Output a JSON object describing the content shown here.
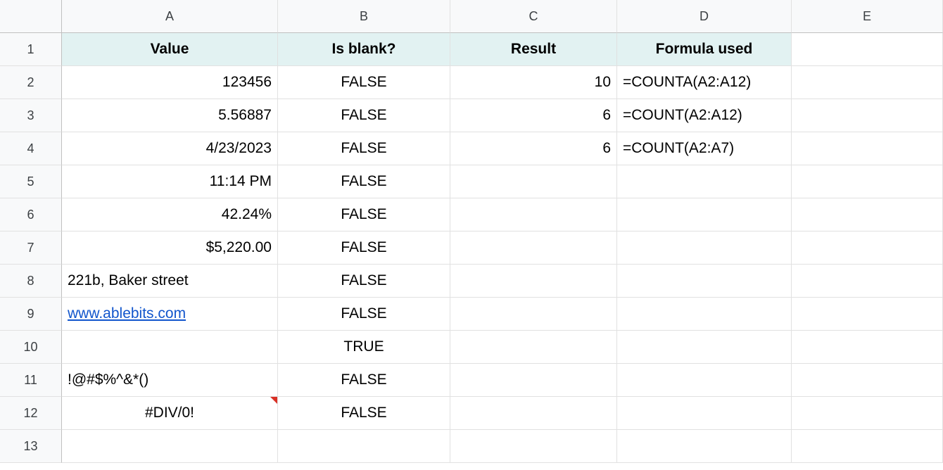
{
  "columns": [
    "A",
    "B",
    "C",
    "D",
    "E"
  ],
  "rowCount": 13,
  "headers": {
    "A": "Value",
    "B": "Is blank?",
    "C": "Result",
    "D": "Formula used"
  },
  "rows": [
    {
      "A": "123456",
      "A_align": "r",
      "B": "FALSE",
      "C": "10",
      "D": "=COUNTA(A2:A12)"
    },
    {
      "A": "5.56887",
      "A_align": "r",
      "B": "FALSE",
      "C": "6",
      "D": "=COUNT(A2:A12)"
    },
    {
      "A": "4/23/2023",
      "A_align": "r",
      "B": "FALSE",
      "C": "6",
      "D": "=COUNT(A2:A7)"
    },
    {
      "A": "11:14 PM",
      "A_align": "r",
      "B": "FALSE",
      "C": "",
      "D": ""
    },
    {
      "A": "42.24%",
      "A_align": "r",
      "B": "FALSE",
      "C": "",
      "D": ""
    },
    {
      "A": "$5,220.00",
      "A_align": "r",
      "B": "FALSE",
      "C": "",
      "D": ""
    },
    {
      "A": "221b, Baker street",
      "A_align": "l",
      "B": "FALSE",
      "C": "",
      "D": ""
    },
    {
      "A": "www.ablebits.com",
      "A_align": "l",
      "A_link": true,
      "B": "FALSE",
      "C": "",
      "D": ""
    },
    {
      "A": "",
      "A_align": "l",
      "B": "TRUE",
      "C": "",
      "D": ""
    },
    {
      "A": "!@#$%^&*()",
      "A_align": "l",
      "B": "FALSE",
      "C": "",
      "D": ""
    },
    {
      "A": "#DIV/0!",
      "A_align": "c",
      "A_note": true,
      "B": "FALSE",
      "C": "",
      "D": ""
    }
  ]
}
